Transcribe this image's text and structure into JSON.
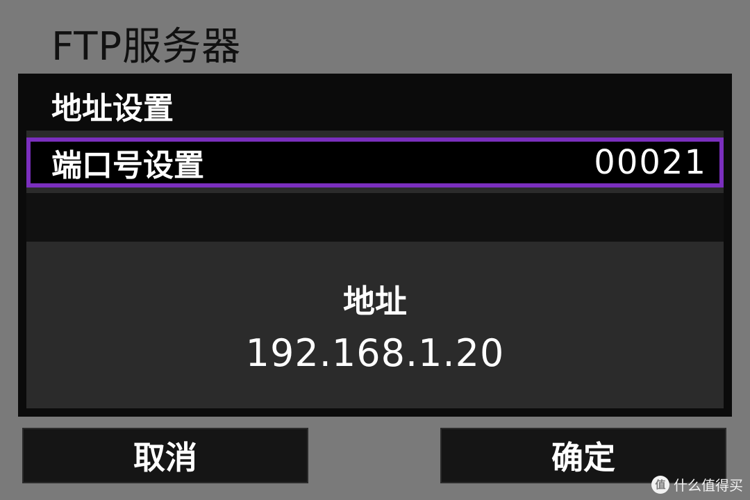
{
  "screen": {
    "title": "FTP服务器"
  },
  "menu": {
    "items": [
      {
        "label": "地址设置",
        "value": ""
      },
      {
        "label": "端口号设置",
        "value": "00021"
      }
    ]
  },
  "info": {
    "label": "地址",
    "value": "192.168.1.20"
  },
  "buttons": {
    "cancel": "取消",
    "ok": "确定"
  },
  "watermark": {
    "text": "什么值得买",
    "logo_glyph": "值"
  },
  "colors": {
    "accent": "#7b2fbe",
    "background": "#7a7a7a"
  }
}
